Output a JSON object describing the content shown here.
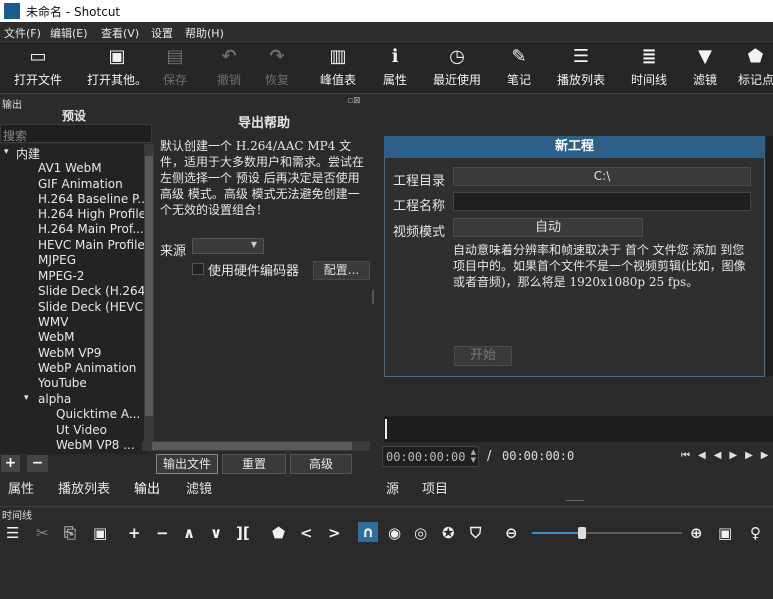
{
  "window": {
    "title": "未命名 - Shotcut"
  },
  "menu": [
    "文件(F)",
    "编辑(E)",
    "查看(V)",
    "设置",
    "帮助(H)"
  ],
  "toolbar": [
    {
      "label": "打开文件",
      "icon": "open-file-icon",
      "glyph": "▭",
      "enabled": true
    },
    {
      "label": "打开其他。",
      "icon": "open-other-icon",
      "glyph": "▣",
      "enabled": true
    },
    {
      "label": "保存",
      "icon": "save-icon",
      "glyph": "▤",
      "enabled": false
    },
    {
      "label": "撤销",
      "icon": "undo-icon",
      "glyph": "↶",
      "enabled": false
    },
    {
      "label": "恢复",
      "icon": "redo-icon",
      "glyph": "↷",
      "enabled": false
    },
    {
      "label": "峰值表",
      "icon": "peak-meter-icon",
      "glyph": "▥",
      "enabled": true
    },
    {
      "label": "属性",
      "icon": "properties-icon",
      "glyph": "ℹ",
      "enabled": true
    },
    {
      "label": "最近使用",
      "icon": "recent-icon",
      "glyph": "◷",
      "enabled": true
    },
    {
      "label": "笔记",
      "icon": "notes-icon",
      "glyph": "✎",
      "enabled": true
    },
    {
      "label": "播放列表",
      "icon": "playlist-icon",
      "glyph": "☰",
      "enabled": true
    },
    {
      "label": "时间线",
      "icon": "timeline-icon",
      "glyph": "≣",
      "enabled": true
    },
    {
      "label": "滤镜",
      "icon": "filter-icon",
      "glyph": "▼",
      "enabled": true
    },
    {
      "label": "标记点",
      "icon": "markers-icon",
      "glyph": "⬟",
      "enabled": true
    }
  ],
  "export": {
    "dock_title": "输出",
    "presets_title": "预设",
    "search_placeholder": "搜索",
    "builtin_label": "内建",
    "presets": [
      "AV1 WebM",
      "GIF Animation",
      "H.264 Baseline P...",
      "H.264 High Profile",
      "H.264 Main Prof...",
      "HEVC Main Profile",
      "MJPEG",
      "MPEG-2",
      "Slide Deck (H.264)",
      "Slide Deck (HEVC)",
      "WMV",
      "WebM",
      "WebM VP9",
      "WebP Animation",
      "YouTube"
    ],
    "alpha_label": "alpha",
    "alpha_presets": [
      "Quicktime A...",
      "Ut Video",
      "WebM VP8 ..."
    ],
    "helper_title": "导出帮助",
    "helper_text": "默认创建一个 H.264/AAC MP4 文件，适用于大多数用户和需求。尝试在左侧选择一个 预设 后再决定是否使用 高级 模式。高级 模式无法避免创建一个无效的设置组合！",
    "source_label": "来源",
    "hw_encoder_label": "使用硬件编码器",
    "configure_button": "配置...",
    "export_file_button": "输出文件",
    "reset_button": "重置",
    "advanced_button": "高级"
  },
  "left_tabs": [
    "属性",
    "播放列表",
    "输出",
    "滤镜"
  ],
  "new_project": {
    "title": "新工程",
    "dir_label": "工程目录",
    "dir_value": "C:\\",
    "name_label": "工程名称",
    "name_value": "",
    "video_mode_label": "视频模式",
    "video_mode_value": "自动",
    "auto_desc": "自动意味着分辨率和帧速取决于 首个 文件您 添加 到您项目中的。如果首个文件不是一个视频剪辑(比如，图像或者音频)，那么将是 1920x1080p 25 fps。",
    "start_button": "开始"
  },
  "player": {
    "timecode": "00:00:00:00",
    "separator": "/",
    "duration": "00:00:00:0",
    "tabs": [
      "源",
      "项目"
    ]
  },
  "timeline": {
    "title": "时间线"
  }
}
